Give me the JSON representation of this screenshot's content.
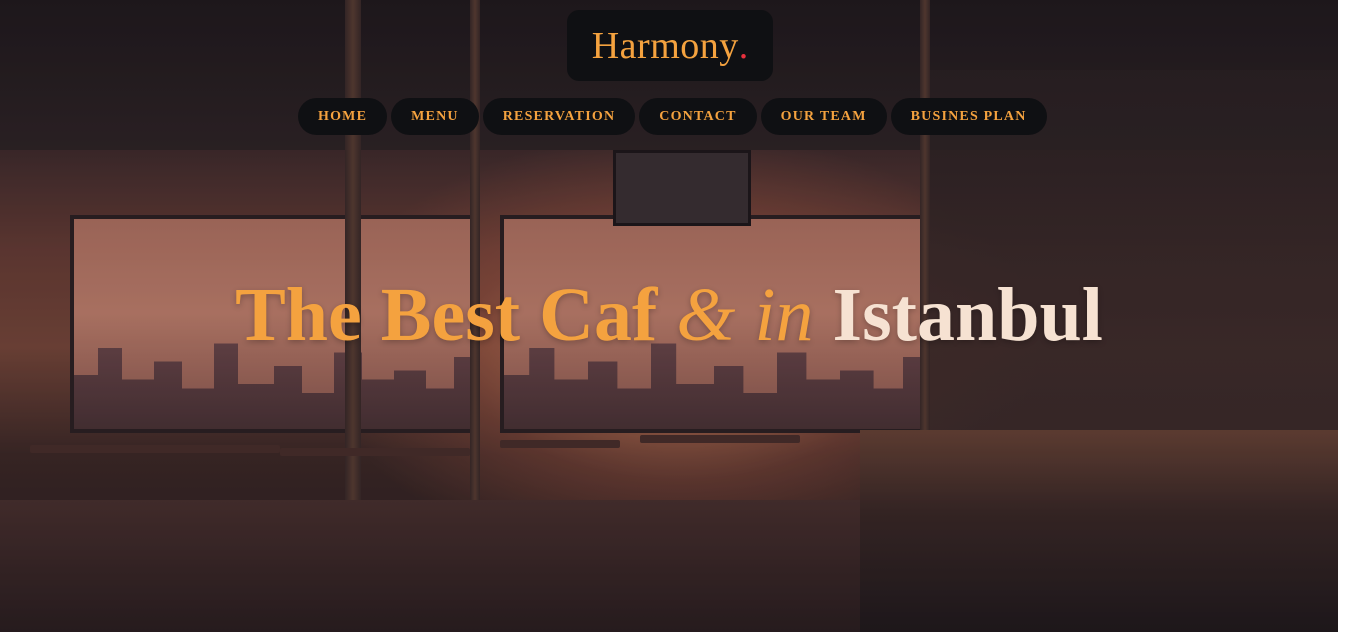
{
  "brand": {
    "name": "Harmony",
    "dot": ".",
    "name_color": "#f4a23f",
    "dot_color": "#e8303d"
  },
  "nav": {
    "items": [
      {
        "label": "HOME"
      },
      {
        "label": "MENU"
      },
      {
        "label": "RESERVATION"
      },
      {
        "label": "CONTACT"
      },
      {
        "label": "OUR TEAM"
      },
      {
        "label": "BUSINES PLAN"
      }
    ]
  },
  "hero": {
    "title_part1": "The Best Caf",
    "title_part2": "& in",
    "title_part3": "Istanbul",
    "accent_color": "#f4a23f",
    "background": "cafe-interior-illustration"
  }
}
